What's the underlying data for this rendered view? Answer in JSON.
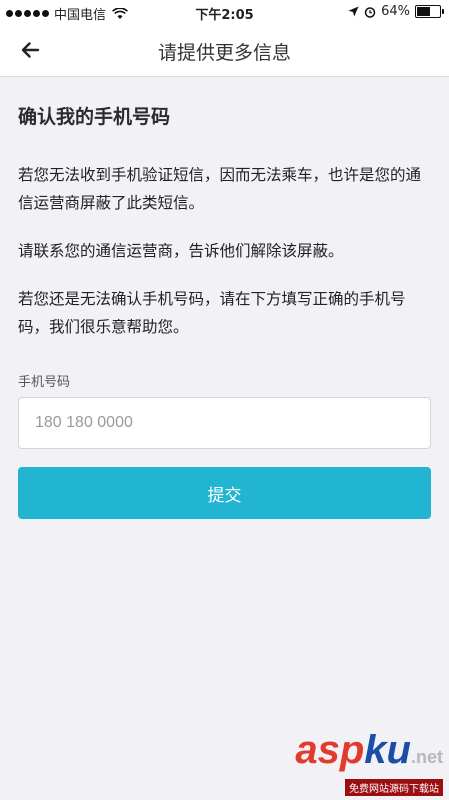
{
  "status_bar": {
    "carrier": "中国电信",
    "time": "下午2:05",
    "battery": "64%",
    "battery_level": 0.64,
    "icons": [
      "signal-dots-icon",
      "wifi-icon",
      "location-arrow-icon",
      "alarm-icon",
      "battery-icon"
    ]
  },
  "nav": {
    "title": "请提供更多信息",
    "back_icon": "arrow-left-icon"
  },
  "main": {
    "heading": "确认我的手机号码",
    "paragraphs": [
      "若您无法收到手机验证短信，因而无法乘车，也许是您的通信运营商屏蔽了此类短信。",
      "请联系您的通信运营商，告诉他们解除该屏蔽。",
      "若您还是无法确认手机号码，请在下方填写正确的手机号码，我们很乐意帮助您。"
    ],
    "phone_label": "手机号码",
    "phone_placeholder": "180 180 0000",
    "phone_value": "",
    "submit_label": "提交"
  },
  "watermark": {
    "logo_part1": "asp",
    "logo_part2": "ku",
    "logo_part3": ".net",
    "subtitle": "免费网站源码下载站"
  },
  "colors": {
    "background": "#f2f1f6",
    "accent": "#22b5d2",
    "watermark_red": "#e23a2c",
    "watermark_blue": "#1a4ea8"
  }
}
